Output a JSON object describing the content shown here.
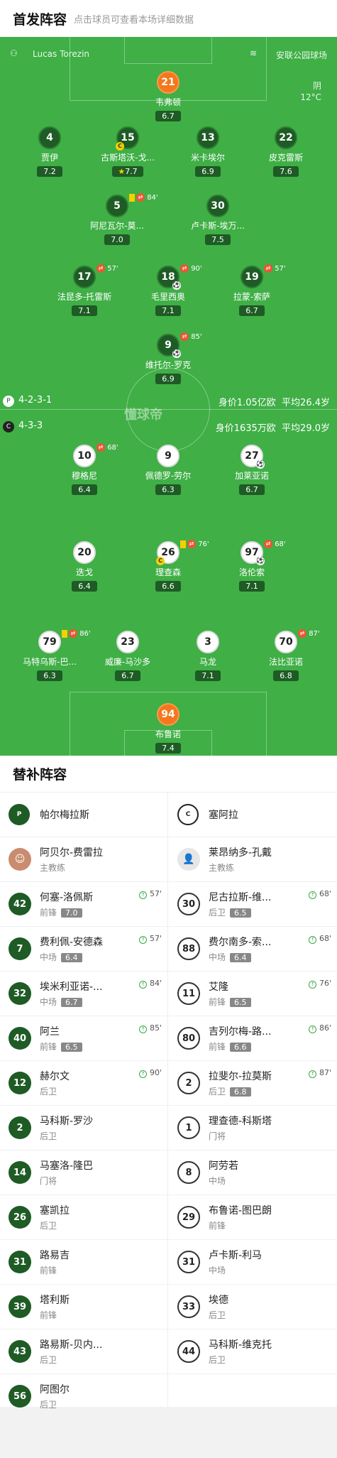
{
  "header": {
    "title": "首发阵容",
    "subtitle": "点击球员可查看本场详细数据"
  },
  "pitch": {
    "referee": "Lucas Torezin",
    "stadium": "安联公园球场",
    "weather": "阴",
    "temp": "12°C",
    "watermark": "懂球帝"
  },
  "home_team": {
    "formation": "4-2-3-1",
    "value": "身价1.05亿欧",
    "age": "平均26.4岁"
  },
  "away_team": {
    "formation": "4-3-3",
    "value": "身价1635万欧",
    "age": "平均29.0岁"
  },
  "home_players": [
    {
      "num": "21",
      "name": "韦弗顿",
      "rating": "6.7"
    },
    {
      "num": "4",
      "name": "贾伊",
      "rating": "7.2"
    },
    {
      "num": "15",
      "name": "古斯塔沃-戈...",
      "rating": "7.7"
    },
    {
      "num": "13",
      "name": "米卡埃尔",
      "rating": "6.9"
    },
    {
      "num": "22",
      "name": "皮克雷斯",
      "rating": "7.6"
    },
    {
      "num": "5",
      "name": "阿尼瓦尔-莫...",
      "rating": "7.0",
      "event": "84'"
    },
    {
      "num": "30",
      "name": "卢卡斯-埃万...",
      "rating": "7.5"
    },
    {
      "num": "17",
      "name": "法昆多-托雷斯",
      "rating": "7.1",
      "event": "57'"
    },
    {
      "num": "18",
      "name": "毛里西奥",
      "rating": "7.1",
      "event": "90'"
    },
    {
      "num": "19",
      "name": "拉蒙-索萨",
      "rating": "6.7",
      "event": "57'"
    },
    {
      "num": "9",
      "name": "维托尔-罗克",
      "rating": "6.9",
      "event": "85'"
    }
  ],
  "away_players": [
    {
      "num": "10",
      "name": "穆格尼",
      "rating": "6.4",
      "event": "68'"
    },
    {
      "num": "9",
      "name": "佩德罗-劳尔",
      "rating": "6.3"
    },
    {
      "num": "27",
      "name": "加莱亚诺",
      "rating": "6.7"
    },
    {
      "num": "20",
      "name": "迭戈",
      "rating": "6.4"
    },
    {
      "num": "26",
      "name": "理查森",
      "rating": "6.6",
      "event": "76'"
    },
    {
      "num": "97",
      "name": "洛伦索",
      "rating": "7.1",
      "event": "68'"
    },
    {
      "num": "79",
      "name": "马特乌斯-巴...",
      "rating": "6.3",
      "event": "86'"
    },
    {
      "num": "23",
      "name": "威廉-马沙多",
      "rating": "6.7"
    },
    {
      "num": "3",
      "name": "马龙",
      "rating": "7.1"
    },
    {
      "num": "70",
      "name": "法比亚诺",
      "rating": "6.8",
      "event": "87'"
    },
    {
      "num": "94",
      "name": "布鲁诺",
      "rating": "7.4"
    }
  ],
  "subs": {
    "title": "替补阵容",
    "home": {
      "team": "帕尔梅拉斯",
      "coach": "阿贝尔-费雷拉",
      "coach_role": "主教练",
      "players": [
        {
          "num": "42",
          "name": "何塞-洛佩斯",
          "pos": "前锋",
          "rating": "7.0",
          "in": "57'"
        },
        {
          "num": "7",
          "name": "费利佩-安德森",
          "pos": "中场",
          "rating": "6.4",
          "in": "57'"
        },
        {
          "num": "32",
          "name": "埃米利亚诺-...",
          "pos": "中场",
          "rating": "6.7",
          "in": "84'"
        },
        {
          "num": "40",
          "name": "阿兰",
          "pos": "前锋",
          "rating": "6.5",
          "in": "85'"
        },
        {
          "num": "12",
          "name": "赫尔文",
          "pos": "后卫",
          "rating": "",
          "in": "90'"
        },
        {
          "num": "2",
          "name": "马科斯-罗沙",
          "pos": "后卫",
          "rating": "",
          "in": ""
        },
        {
          "num": "14",
          "name": "马塞洛-隆巴",
          "pos": "门将",
          "rating": "",
          "in": ""
        },
        {
          "num": "26",
          "name": "塞凯拉",
          "pos": "后卫",
          "rating": "",
          "in": ""
        },
        {
          "num": "31",
          "name": "路易吉",
          "pos": "前锋",
          "rating": "",
          "in": ""
        },
        {
          "num": "39",
          "name": "塔利斯",
          "pos": "前锋",
          "rating": "",
          "in": ""
        },
        {
          "num": "43",
          "name": "路易斯-贝内...",
          "pos": "后卫",
          "rating": "",
          "in": ""
        },
        {
          "num": "56",
          "name": "阿图尔",
          "pos": "后卫",
          "rating": "",
          "in": ""
        }
      ]
    },
    "away": {
      "team": "塞阿拉",
      "coach": "莱昂纳多-孔戴",
      "coach_role": "主教练",
      "players": [
        {
          "num": "30",
          "name": "尼古拉斯-维...",
          "pos": "后卫",
          "rating": "6.5",
          "in": "68'"
        },
        {
          "num": "88",
          "name": "费尔南多-索...",
          "pos": "中场",
          "rating": "6.4",
          "in": "68'"
        },
        {
          "num": "11",
          "name": "艾隆",
          "pos": "前锋",
          "rating": "6.5",
          "in": "76'"
        },
        {
          "num": "80",
          "name": "吉列尔梅-路...",
          "pos": "前锋",
          "rating": "6.6",
          "in": "86'"
        },
        {
          "num": "2",
          "name": "拉斐尔-拉莫斯",
          "pos": "后卫",
          "rating": "6.8",
          "in": "87'"
        },
        {
          "num": "1",
          "name": "理查德-科斯塔",
          "pos": "门将",
          "rating": "",
          "in": ""
        },
        {
          "num": "8",
          "name": "阿劳若",
          "pos": "中场",
          "rating": "",
          "in": ""
        },
        {
          "num": "29",
          "name": "布鲁诺-图巴朗",
          "pos": "前锋",
          "rating": "",
          "in": ""
        },
        {
          "num": "31",
          "name": "卢卡斯-利马",
          "pos": "中场",
          "rating": "",
          "in": ""
        },
        {
          "num": "33",
          "name": "埃德",
          "pos": "后卫",
          "rating": "",
          "in": ""
        },
        {
          "num": "44",
          "name": "马科斯-维克托",
          "pos": "后卫",
          "rating": "",
          "in": ""
        }
      ]
    }
  }
}
